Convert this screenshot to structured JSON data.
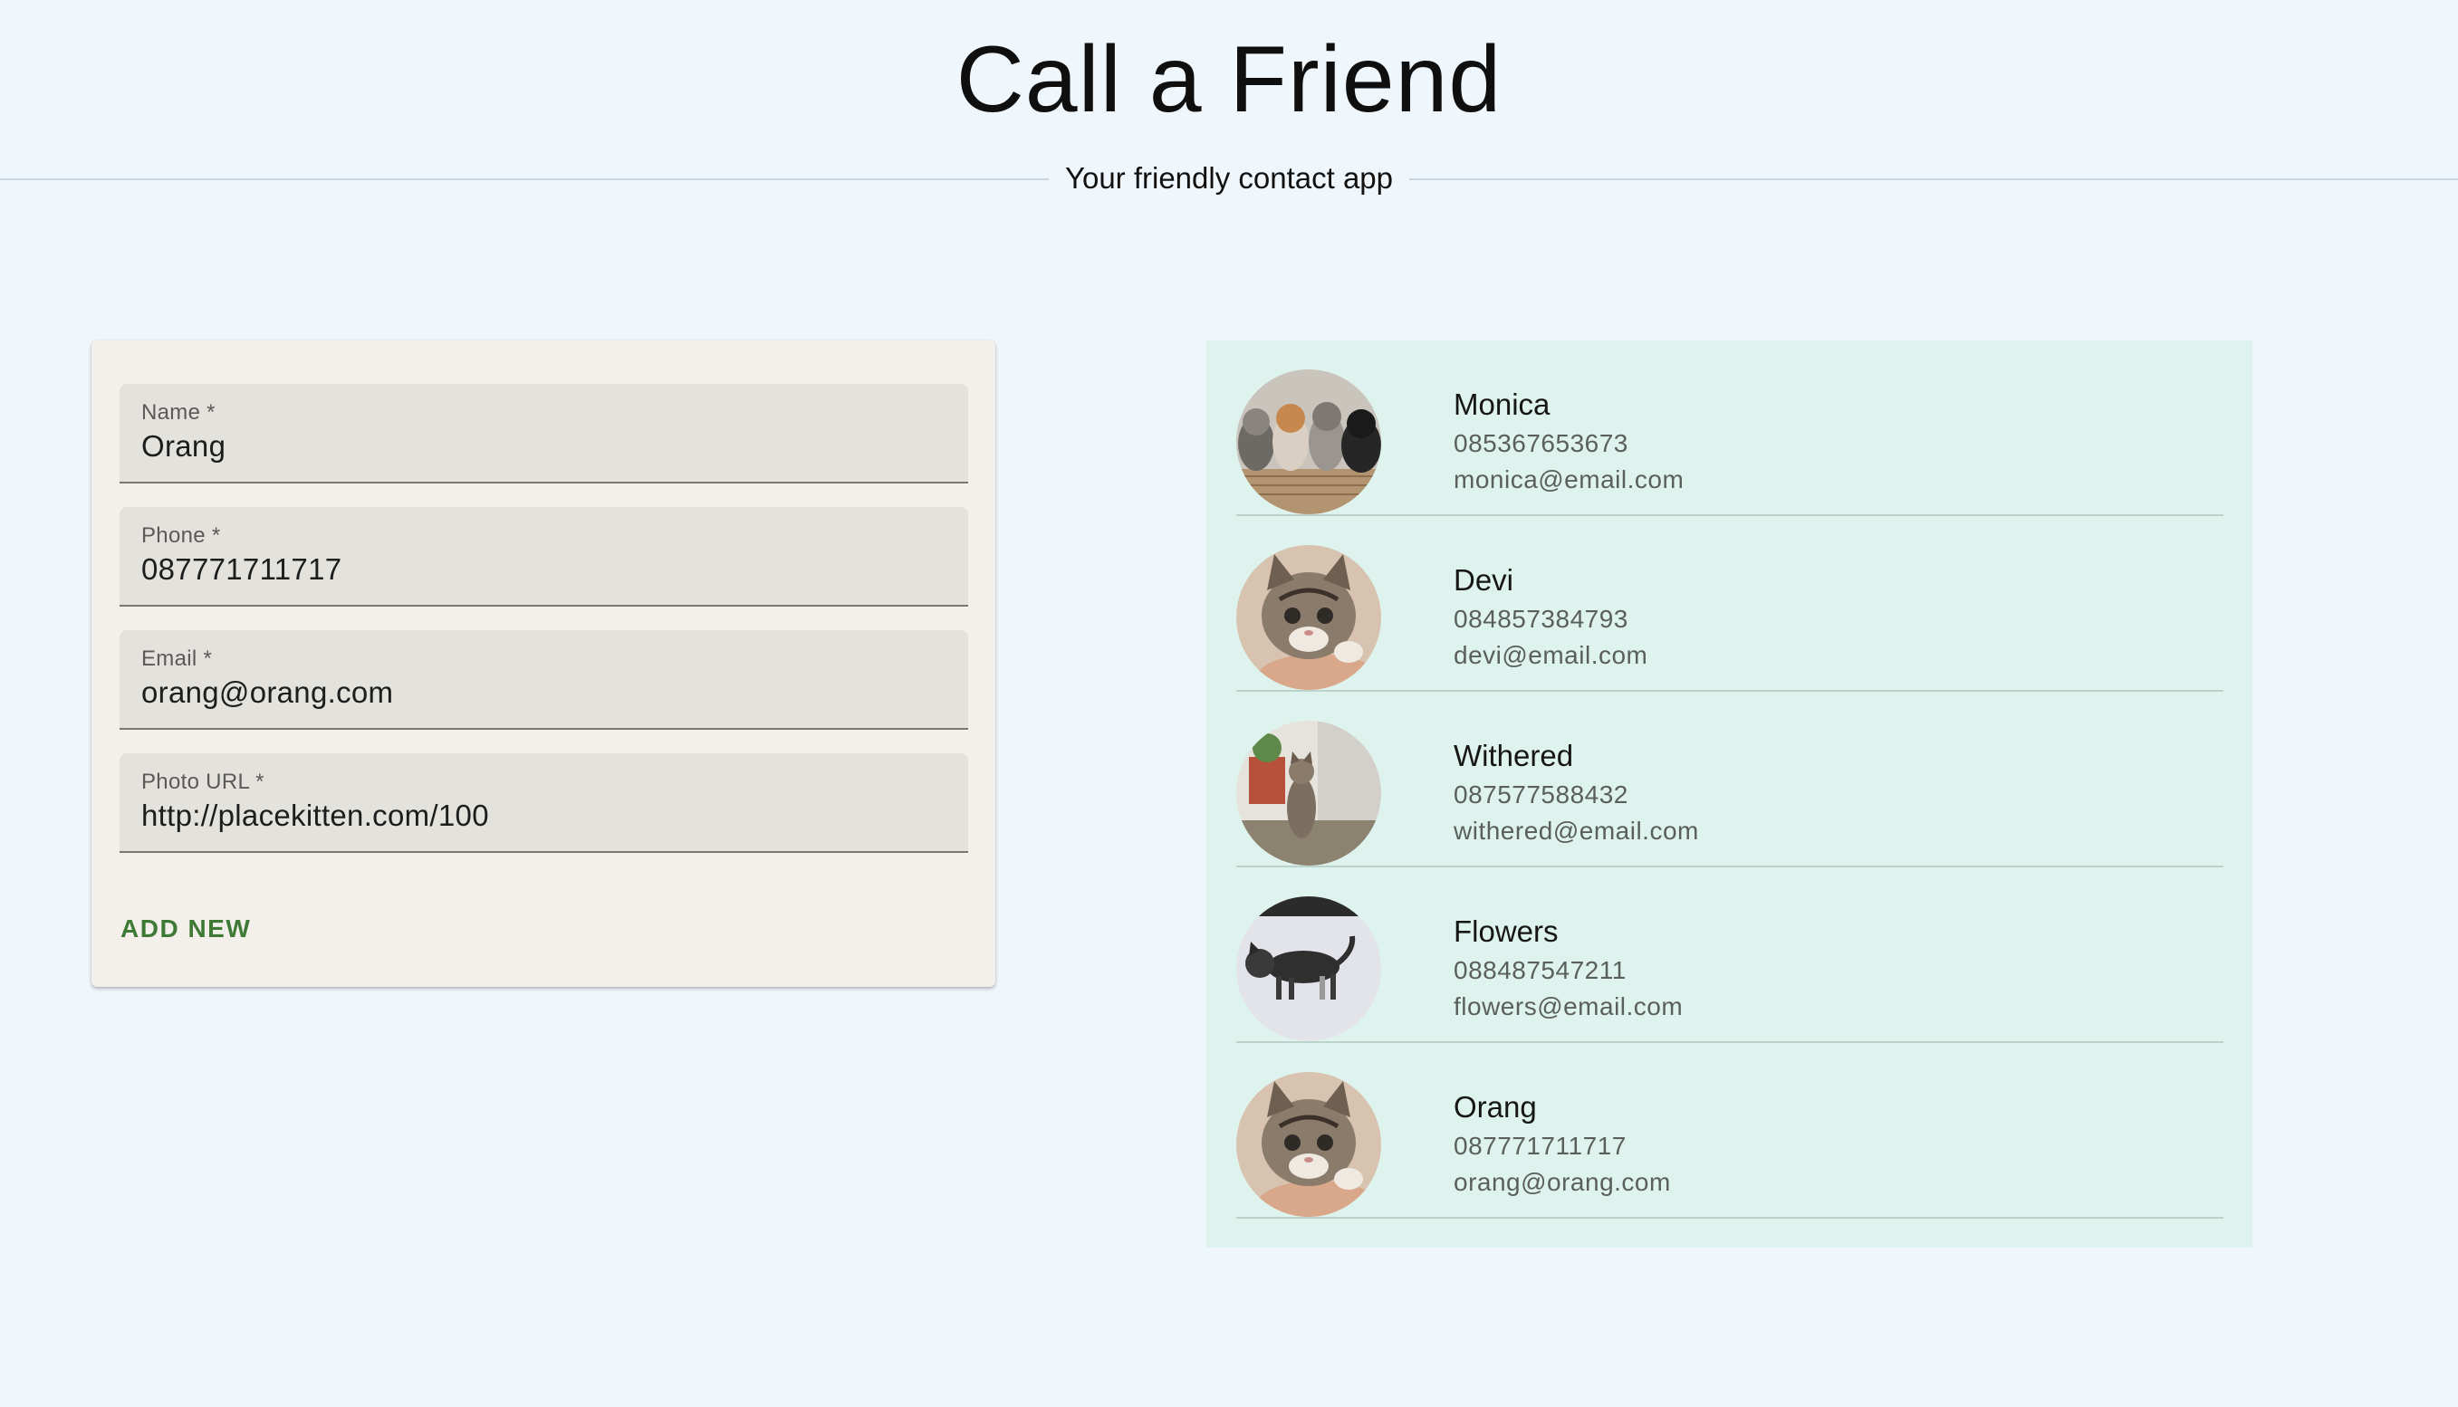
{
  "header": {
    "title": "Call a Friend",
    "subtitle": "Your friendly contact app"
  },
  "form": {
    "fields": [
      {
        "label": "Name *",
        "value": "Orang"
      },
      {
        "label": "Phone *",
        "value": "087771711717"
      },
      {
        "label": "Email *",
        "value": "orang@orang.com"
      },
      {
        "label": "Photo URL *",
        "value": "http://placekitten.com/100"
      }
    ],
    "submit_label": "ADD NEW"
  },
  "contacts": [
    {
      "name": "Monica",
      "phone": "085367653673",
      "email": "monica@email.com",
      "avatar": "kitten-group-photo"
    },
    {
      "name": "Devi",
      "phone": "084857384793",
      "email": "devi@email.com",
      "avatar": "kitten-closeup-photo"
    },
    {
      "name": "Withered",
      "phone": "087577588432",
      "email": "withered@email.com",
      "avatar": "kitten-standing-photo"
    },
    {
      "name": "Flowers",
      "phone": "088487547211",
      "email": "flowers@email.com",
      "avatar": "kitten-walking-photo"
    },
    {
      "name": "Orang",
      "phone": "087771711717",
      "email": "orang@orang.com",
      "avatar": "kitten-closeup-photo"
    }
  ],
  "colors": {
    "background": "#eff7fd",
    "card": "#f3f0ec",
    "list_panel": "#dff3ee",
    "accent_button": "#3e7a35"
  }
}
